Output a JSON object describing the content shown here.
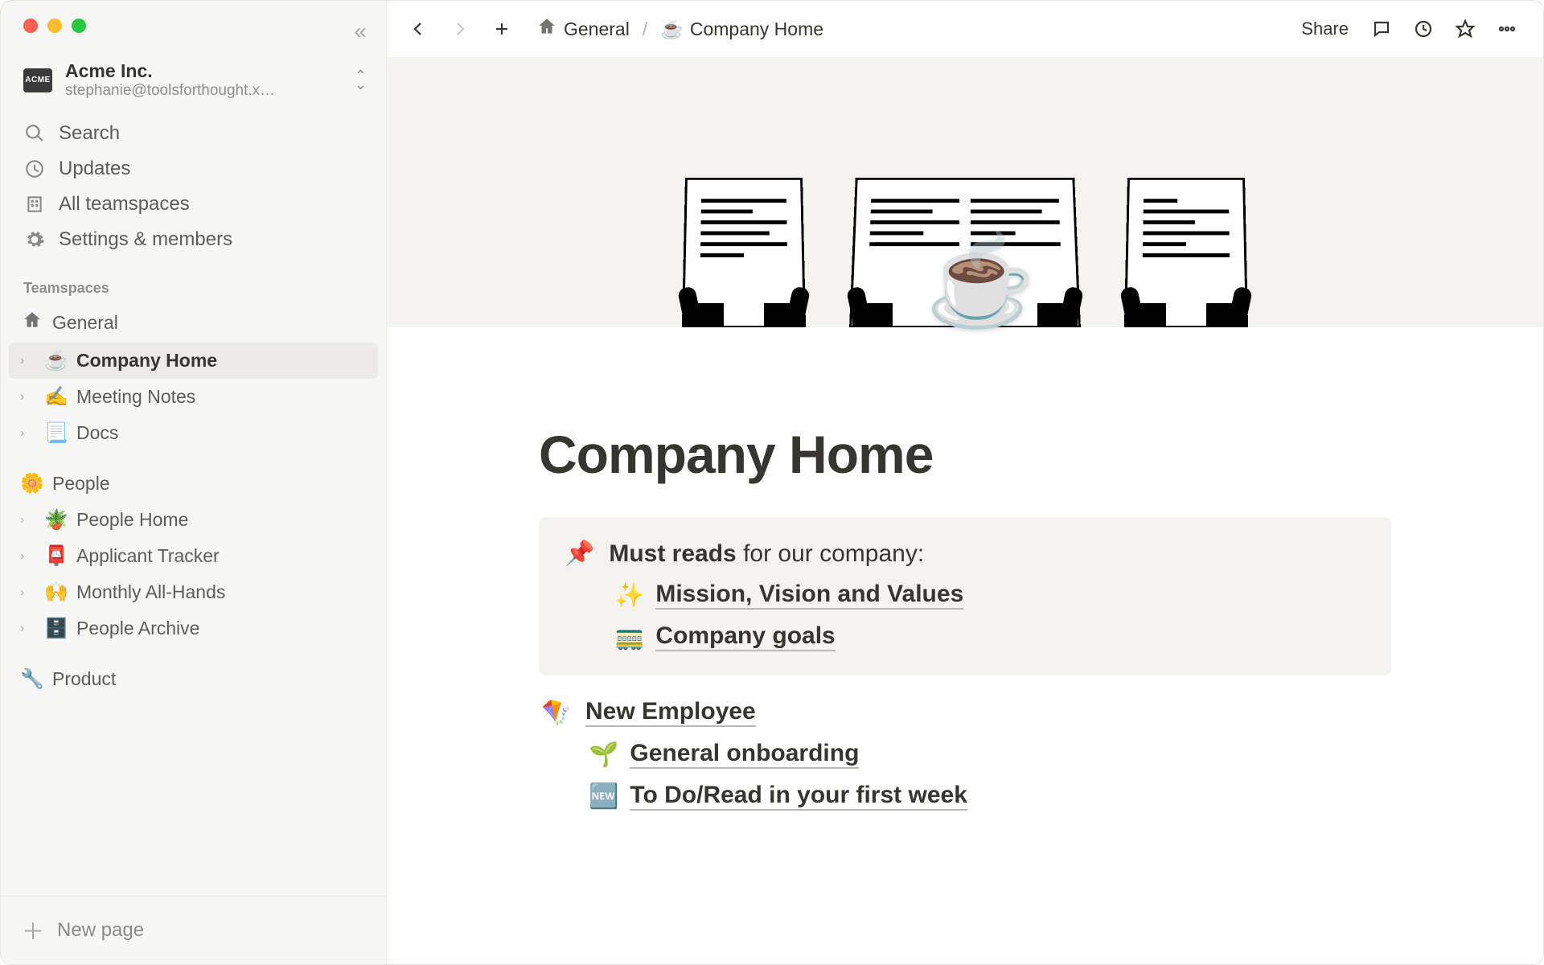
{
  "window": {
    "traffic_lights": [
      "close",
      "minimize",
      "zoom"
    ]
  },
  "workspace": {
    "badge": "ACME",
    "name": "Acme Inc.",
    "email": "stephanie@toolsforthought.x…"
  },
  "sidebar": {
    "nav": [
      {
        "id": "search",
        "label": "Search",
        "icon": "search-icon"
      },
      {
        "id": "updates",
        "label": "Updates",
        "icon": "clock-icon"
      },
      {
        "id": "teamspaces",
        "label": "All teamspaces",
        "icon": "building-icon"
      },
      {
        "id": "settings",
        "label": "Settings & members",
        "icon": "gear-icon"
      }
    ],
    "section_label": "Teamspaces",
    "teamspaces": [
      {
        "name": "General",
        "emoji": "🏠",
        "emoji_mono": true,
        "children": [
          {
            "emoji": "☕",
            "label": "Company Home",
            "active": true
          },
          {
            "emoji": "✍️",
            "label": "Meeting Notes"
          },
          {
            "emoji": "📃",
            "label": "Docs"
          }
        ]
      },
      {
        "name": "People",
        "emoji": "🌼",
        "children": [
          {
            "emoji": "🪴",
            "label": "People Home"
          },
          {
            "emoji": "📮",
            "label": "Applicant Tracker"
          },
          {
            "emoji": "🙌",
            "label": "Monthly All-Hands"
          },
          {
            "emoji": "🗄️",
            "label": "People Archive"
          }
        ]
      },
      {
        "name": "Product",
        "emoji": "🔧",
        "children": []
      }
    ],
    "new_page": "New page"
  },
  "topbar": {
    "breadcrumb": [
      {
        "emoji": "home-svg",
        "label": "General"
      },
      {
        "emoji": "☕",
        "label": "Company Home"
      }
    ],
    "share": "Share"
  },
  "page": {
    "icon": "☕",
    "title": "Company Home",
    "blocks": [
      {
        "type": "callout",
        "emoji": "📌",
        "head_bold": "Must reads",
        "head_rest": " for our company:",
        "links": [
          {
            "emoji": "✨",
            "text": "Mission, Vision and Values"
          },
          {
            "emoji": "🚃",
            "text": "Company goals"
          }
        ]
      },
      {
        "type": "plain",
        "emoji": "🪁",
        "head_link": "New Employee",
        "links": [
          {
            "emoji": "🌱",
            "text": "General onboarding"
          },
          {
            "emoji": "🆕",
            "text": "To Do/Read in your first week"
          }
        ]
      }
    ]
  }
}
